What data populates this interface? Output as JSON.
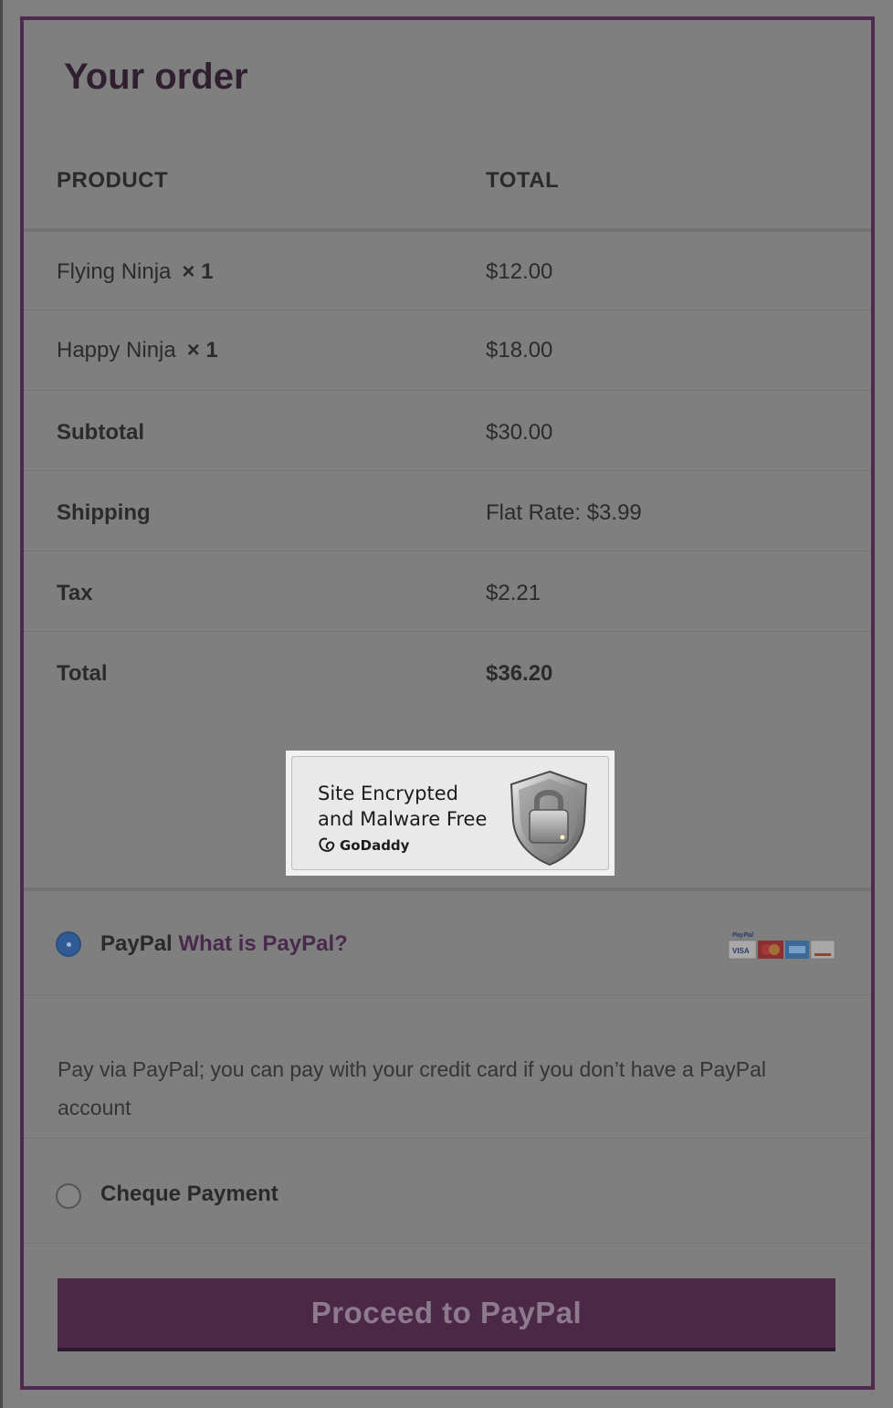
{
  "order": {
    "title": "Your order",
    "columns": {
      "product": "PRODUCT",
      "total": "TOTAL"
    },
    "items": [
      {
        "name": "Flying Ninja",
        "qty": "× 1",
        "total": "$12.00"
      },
      {
        "name": "Happy Ninja",
        "qty": "× 1",
        "total": "$18.00"
      }
    ],
    "totals": [
      {
        "label": "Subtotal",
        "value": "$30.00"
      },
      {
        "label": "Shipping",
        "value": "Flat Rate: $3.99"
      },
      {
        "label": "Tax",
        "value": "$2.21"
      },
      {
        "label": "Total",
        "value": "$36.20"
      }
    ]
  },
  "badge": {
    "line1": "Site Encrypted",
    "line2": "and Malware Free",
    "brand": "GoDaddy",
    "icons": {
      "brand": "godaddy-logo-icon",
      "shield": "shield-lock-icon"
    }
  },
  "payment": {
    "paypal": {
      "label": "PayPal",
      "link": "What is PayPal?",
      "selected": true
    },
    "paypal_desc": "Pay via PayPal; you can pay with your credit card if you don’t have a PayPal account",
    "cheque": {
      "label": "Cheque Payment",
      "selected": false
    },
    "button": "Proceed to PayPal"
  },
  "colors": {
    "accent": "#4b2848",
    "radio_selected": "#2f5c94"
  }
}
